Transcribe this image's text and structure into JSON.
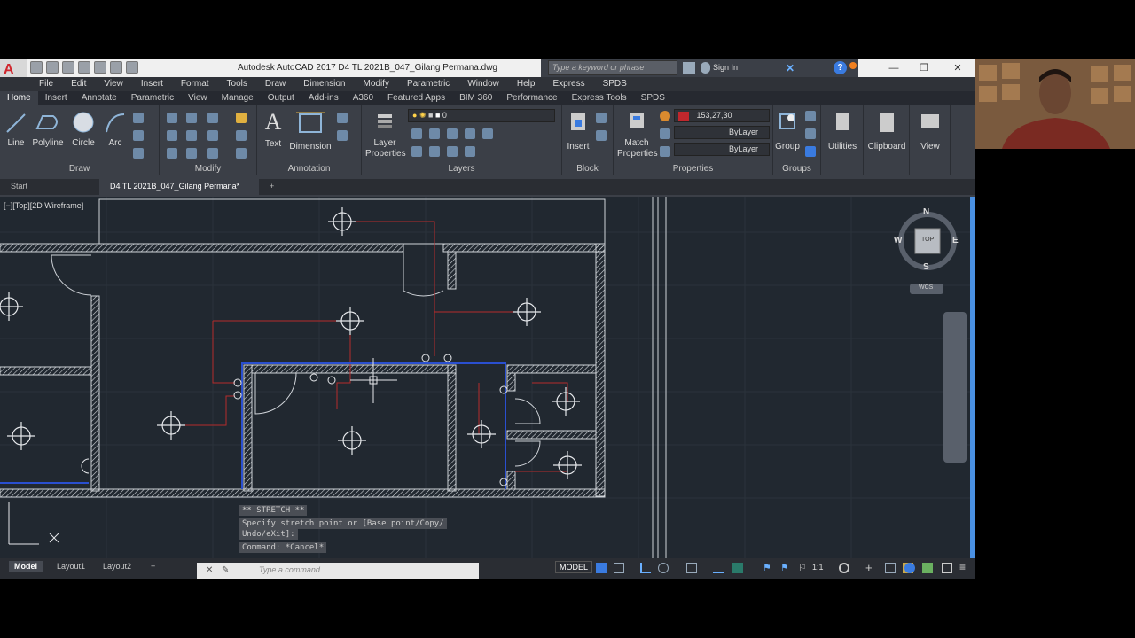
{
  "titlebar": {
    "app_title": "Autodesk AutoCAD 2017    D4 TL 2021B_047_Gilang Permana.dwg",
    "search_placeholder": "Type a keyword or phrase",
    "sign_in": "Sign In"
  },
  "menu": [
    "File",
    "Edit",
    "View",
    "Insert",
    "Format",
    "Tools",
    "Draw",
    "Dimension",
    "Modify",
    "Parametric",
    "Window",
    "Help",
    "Express",
    "SPDS"
  ],
  "ribbon_tabs": [
    "Home",
    "Insert",
    "Annotate",
    "Parametric",
    "View",
    "Manage",
    "Output",
    "Add-ins",
    "A360",
    "Featured Apps",
    "BIM 360",
    "Performance",
    "Express Tools",
    "SPDS"
  ],
  "ribbon": {
    "draw": {
      "title": "Draw",
      "line": "Line",
      "polyline": "Polyline",
      "circle": "Circle",
      "arc": "Arc"
    },
    "modify": {
      "title": "Modify"
    },
    "annotation": {
      "title": "Annotation",
      "text": "Text",
      "dimension": "Dimension"
    },
    "layers": {
      "title": "Layers",
      "layer_properties": "Layer Properties",
      "current_layer": "0"
    },
    "block": {
      "title": "Block",
      "insert": "Insert"
    },
    "properties": {
      "title": "Properties",
      "match": "Match Properties",
      "color": "153,27,30",
      "linetype": "ByLayer",
      "lineweight": "ByLayer"
    },
    "groups": {
      "title": "Groups",
      "group": "Group"
    },
    "utilities": "Utilities",
    "clipboard": "Clipboard",
    "view": "View"
  },
  "doc_tabs": {
    "start": "Start",
    "current": "D4 TL 2021B_047_Gilang Permana*"
  },
  "viewport": {
    "label": "[−][Top][2D Wireframe]"
  },
  "viewcube": {
    "n": "N",
    "s": "S",
    "e": "E",
    "w": "W",
    "top": "TOP",
    "wcs": "WCS"
  },
  "command": {
    "line1": "** STRETCH **",
    "line2": "Specify stretch point or [Base point/Copy/",
    "line3": "Undo/eXit]:",
    "line4": "Command: *Cancel*",
    "placeholder": "Type a command"
  },
  "layouts": [
    "Model",
    "Layout1",
    "Layout2"
  ],
  "status": {
    "model": "MODEL",
    "scale": "1:1"
  },
  "colors": {
    "layer_color": "#c0272d",
    "wall": "#cfd3d8",
    "wire": "#b52b2b",
    "selection": "#2a4fd0"
  }
}
